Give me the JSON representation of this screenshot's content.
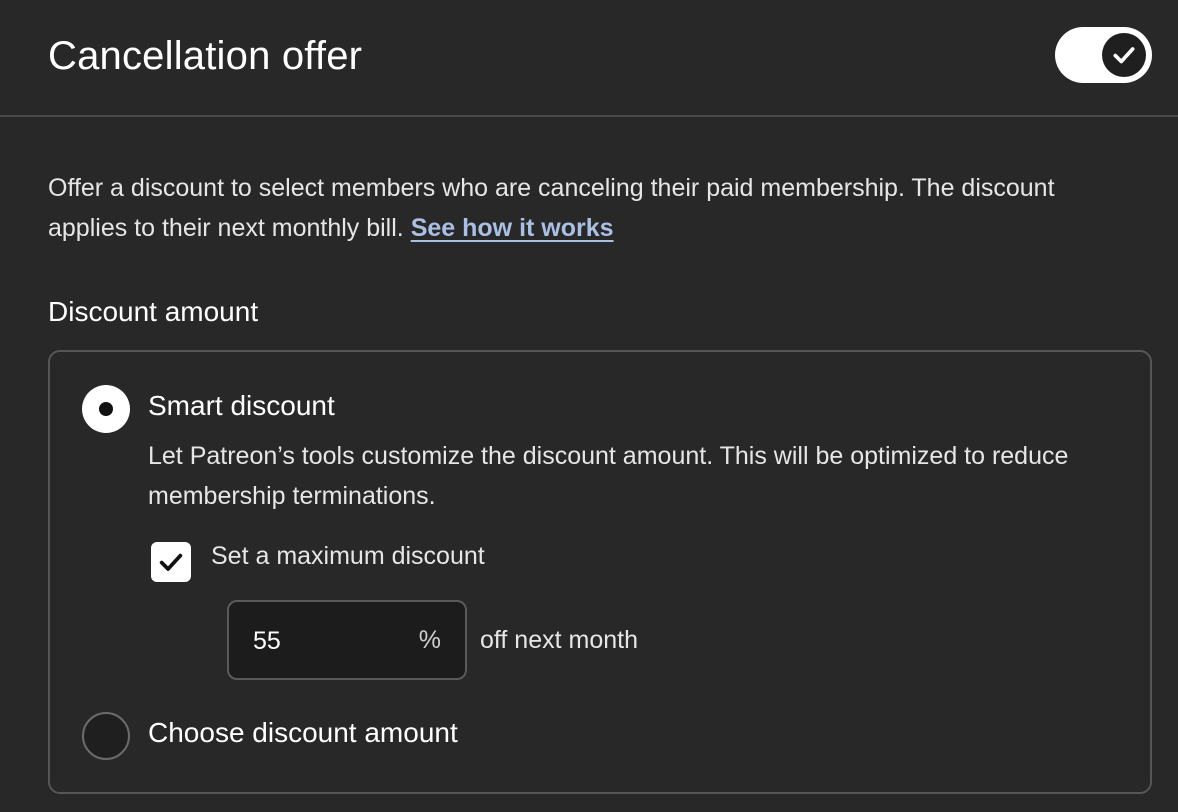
{
  "header": {
    "title": "Cancellation offer",
    "toggle_on": true
  },
  "description": {
    "text": "Offer a discount to select members who are canceling their paid membership. The discount applies to their next monthly bill.",
    "link_text": "See how it works"
  },
  "discount_section": {
    "label": "Discount amount",
    "options": [
      {
        "label": "Smart discount",
        "selected": true,
        "description": "Let Patreon’s tools customize the discount amount. This will be optimized to reduce membership terminations."
      },
      {
        "label": "Choose discount amount",
        "selected": false
      }
    ],
    "max_discount": {
      "checkbox_label": "Set a maximum discount",
      "checked": true,
      "value": "55",
      "suffix": "%",
      "after_text": "off next month"
    }
  },
  "colors": {
    "background": "#282828",
    "link": "#a9bfe3",
    "border": "#565656"
  }
}
